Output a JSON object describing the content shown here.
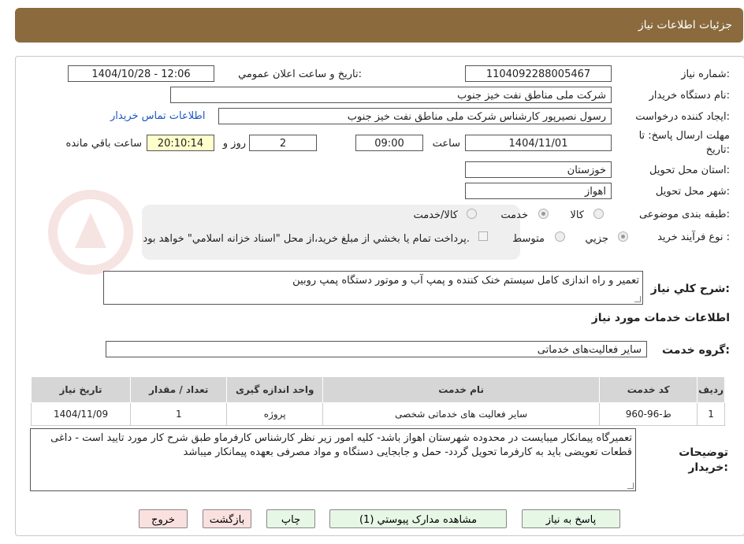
{
  "header": {
    "title": "جزئيات اطلاعات نياز"
  },
  "fields": {
    "need_number_label": "شماره نياز:",
    "need_number": "1104092288005467",
    "announce_label": "تاريخ و ساعت اعلان عمومي:",
    "announce_value": "1404/10/28 - 12:06",
    "buyer_org_label": "نام دستگاه خريدار:",
    "buyer_org": "شرکت ملی مناطق نفت خیز جنوب",
    "requester_label": "ايجاد کننده درخواست:",
    "requester": "رسول نصیرپور کارشناس شرکت ملی مناطق نفت خیز جنوب",
    "contact_link": "اطلاعات تماس خريدار",
    "deadline_label_1": "مهلت ارسال پاسخ: تا",
    "deadline_label_2": "تاريخ:",
    "deadline_date": "1404/11/01",
    "time_label": "ساعت",
    "deadline_time": "09:00",
    "days_value": "2",
    "days_label": "روز و",
    "remaining_time": "20:10:14",
    "remaining_label": "ساعت باقي مانده",
    "province_label": "استان محل تحويل:",
    "province": "خوزستان",
    "city_label": "شهر محل تحويل:",
    "city": "اهواز",
    "category_label": "طبقه بندی موضوعی:",
    "category_options": [
      "کالا",
      "خدمت",
      "کالا/خدمت"
    ],
    "category_selected": "خدمت",
    "process_label": "نوع فرآيند خريد :",
    "process_options": [
      "جزيي",
      "متوسط"
    ],
    "process_selected": "جزيي",
    "payment_note": "پرداخت تمام يا بخشي از مبلغ خريد،از محل \"اسناد خزانه اسلامي\" خواهد بود."
  },
  "description": {
    "label": "شرح کلي نياز:",
    "text": "تعمیر و راه اندازی کامل سیستم خنک کننده و پمپ آب  و موتور دستگاه پمپ روبین"
  },
  "services": {
    "section_title": "اطلاعات خدمات مورد نياز",
    "group_label": "گروه خدمت:",
    "group_value": "ساير فعاليت‌هاى خدماتى",
    "columns": [
      "رديف",
      "کد خدمت",
      "نام خدمت",
      "واحد اندازه گيری",
      "تعداد / مقدار",
      "تاريخ نياز"
    ],
    "rows": [
      [
        "1",
        "ط-96-960",
        "سایر فعالیت های خدماتی شخصی",
        "پروژه",
        "1",
        "1404/11/09"
      ]
    ]
  },
  "buyer_notes": {
    "label_1": "توضيحات",
    "label_2": "خريدار:",
    "text": "تعمیرگاه پیمانکار میبایست در محدوده شهرستان اهواز باشد- کلیه امور زیر نظر کارشناس کارفرماو طبق شرح کار مورد تایید است - داغی قطعات تعویضی باید به کارفرما تحویل گردد- حمل و جابجایی دستگاه و مواد مصرفی بعهده پیمانکار میباشد"
  },
  "buttons": {
    "reply": "پاسخ به نياز",
    "attachments": "مشاهده مدارک پيوستي (1)",
    "print": "چاپ",
    "back": "بازگشت",
    "exit": "خروج"
  },
  "colors": {
    "header_bg": "#8b6a3e",
    "link": "#1a56c4",
    "button_green": "#e6f7e6",
    "button_pink": "#fbe0e0",
    "remaining_bg": "#ffffcc"
  }
}
